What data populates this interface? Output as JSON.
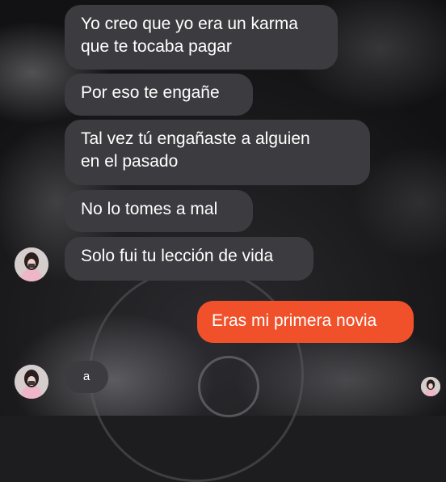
{
  "conversation": {
    "messages": [
      {
        "lines": [
          "Yo creo que yo era un karma",
          "que te tocaba pagar"
        ]
      },
      {
        "lines": [
          "Por eso te engañe"
        ]
      },
      {
        "lines": [
          "Tal vez tú engañaste a alguien",
          "en el pasado"
        ]
      },
      {
        "lines": [
          "No lo tomes a mal"
        ]
      },
      {
        "lines": [
          "Solo fui tu lección de vida"
        ]
      }
    ],
    "sent_message": "Eras mi primera novia",
    "last_received": "a"
  },
  "colors": {
    "received_bubble": "#3c3c40",
    "sent_bubble": "#f0512a",
    "text": "#ffffff"
  },
  "icons": {
    "contact_avatar": "contact-avatar-icon",
    "seen_avatar": "seen-avatar-icon"
  }
}
